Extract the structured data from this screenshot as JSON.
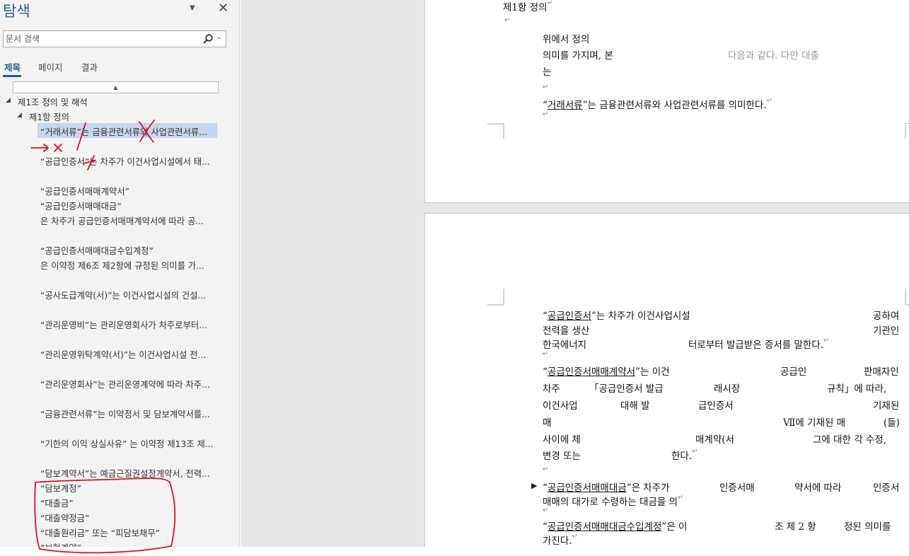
{
  "nav": {
    "title": "탐색",
    "close_symbol": "✕",
    "dropdown_symbol": "▼",
    "search": {
      "placeholder": "문서 검색",
      "icon": "search-icon",
      "chevron": "⌄"
    },
    "tabs": [
      {
        "label": "제목",
        "active": true
      },
      {
        "label": "페이지",
        "active": false
      },
      {
        "label": "결과",
        "active": false
      }
    ],
    "collapse_symbol": "▲",
    "tree": {
      "l1": "제1조 정의 및 해석",
      "l2": "제1항  정의",
      "items": [
        "“거래서류”는 금융관련서류와 사업관련서류...",
        "“공급인증서”는 차주가 이건사업시설에서 태...",
        "“공급인증서매매계약서”",
        "“공급인증서매매대금”",
        "은 차주가 공급인증서매매계약서에 따라 공...",
        "“공급인증서매매대금수입계정”",
        "은 이약정 제6조 제2항에 규정된 의미를 가...",
        "“공사도급계약(서)”는 이건사업시설의 건설...",
        "“관리운영비”는 관리운영회사가 차주로부터...",
        "“관리운영위탁계약(서)”는 이건사업시설 전...",
        "“관리운영회사”는 관리운영계약에 따라 차주...",
        "“금융관련서류”는 이약정서 및 담보계약서를...",
        "“기한의 이익 상실사유” 는 이약정 제13조 제...",
        "“담보계약서”는 예금근질권설정계약서, 전력...",
        "“담보계정”",
        "“대출금”",
        "“대출약정금”",
        "“대출원리금” 또는 “피담보채무”",
        "“보험계약”"
      ]
    }
  },
  "doc": {
    "page1": {
      "heading": "제1항  정의",
      "line1": "위에서  정의",
      "line2": "의미를 가지며, 본",
      "line2b": "다음과 같다. 다만 대출",
      "line3": "는",
      "def_term": "거래서류",
      "def_rest": "”는 금융관련서류와 사업관련서류를 의미한다."
    },
    "page2": {
      "p1_term": "공급인증서",
      "p1_l1_rest": "”는   차주가   이건사업시설",
      "p1_l1_end": "공하여",
      "p1_l2a": "전력을   생산",
      "p1_l2b": "기관인",
      "p1_l3a": "한국에너지",
      "p1_l3b": "터로부터  발급받은  증서를  말한다.",
      "p2_term": "공급인증서매매계약서",
      "p2_l1_rest": "”는   이건",
      "p2_l1_mid": "공급인",
      "p2_l1_end": "판매자인",
      "p2_l2a": "차주",
      "p2_l2b": "「공급인증서   발급",
      "p2_l2c": "래시장",
      "p2_l2d": "규칙」에  따라,",
      "p2_l3a": "이건사업",
      "p2_l3b": "대해   발",
      "p2_l3c": "급인증서",
      "p2_l3d": "기재된",
      "p2_l4a": "매",
      "p2_l4b": "Ⅶ에  기재된  매",
      "p2_l4c": "(들)",
      "p2_l5a": "사이에  체",
      "p2_l5b": "매계약(서",
      "p2_l5c": "그에  대한  각  수정,",
      "p2_l6": "변경  또는",
      "p2_l6b": "한다.",
      "p3_term": "공급인증서매매대금",
      "p3_l1_rest": "”은   차주가",
      "p3_l1_mid": "인증서매",
      "p3_l1_mid2": "약서에  따라",
      "p3_l1_end": "인증서",
      "p3_l2": "매매의  대가로  수령하는  대금을  의",
      "p4_term": "공급인증서매매대금수입계정",
      "p4_l1_rest": "”은  이",
      "p4_l1_mid": "조  제 2  항",
      "p4_l1_end": "정된  의미를",
      "p4_l2": "가진다."
    },
    "para_mark": "↵",
    "bullet": "▶"
  },
  "colors": {
    "accent": "#2b579a",
    "selection": "#c5d6ee",
    "annotation_red": "#e0101a"
  }
}
